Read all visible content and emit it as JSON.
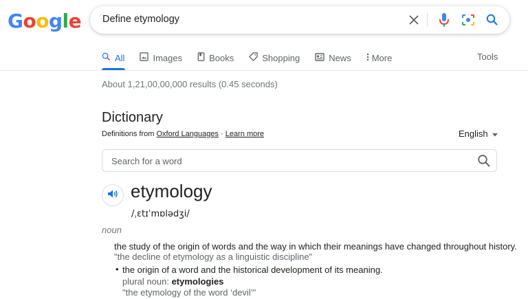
{
  "logo": {
    "letters": [
      "G",
      "o",
      "o",
      "g",
      "l",
      "e"
    ],
    "colors": [
      "#4285f4",
      "#ea4335",
      "#fbbc05",
      "#4285f4",
      "#34a853",
      "#ea4335"
    ]
  },
  "search": {
    "query": "Define etymology"
  },
  "icons": {
    "clear": "close-icon",
    "voice": "mic-icon",
    "lens": "camera-icon",
    "search": "search-icon"
  },
  "tabs": [
    {
      "label": "All",
      "icon": "search-icon",
      "active": true
    },
    {
      "label": "Images",
      "icon": "image-icon"
    },
    {
      "label": "Books",
      "icon": "book-icon"
    },
    {
      "label": "Shopping",
      "icon": "tag-icon"
    },
    {
      "label": "News",
      "icon": "news-icon"
    },
    {
      "label": "More",
      "icon": "more-vert-icon"
    }
  ],
  "tools_label": "Tools",
  "result_stats": "About 1,21,00,00,000 results (0.45 seconds)",
  "dictionary": {
    "title": "Dictionary",
    "source_prefix": "Definitions from ",
    "source_link": "Oxford Languages",
    "separator": " · ",
    "learn_more": "Learn more",
    "language": "English",
    "word_search_placeholder": "Search for a word",
    "headword": "etymology",
    "phonetic": "/ˌɛtɪˈmɒlədʒi/",
    "part_of_speech": "noun",
    "definitions": [
      {
        "text": "the study of the origin of words and the way in which their meanings have changed throughout history.",
        "example": "\"the decline of etymology as a linguistic discipline\""
      },
      {
        "text": "the origin of a word and the historical development of its meaning.",
        "plural_label": "plural noun: ",
        "plural_value": "etymologies",
        "example": "\"the etymology of the word ‘devil’\""
      }
    ]
  },
  "colors": {
    "accent": "#1a73e8",
    "text": "#202124",
    "muted": "#70757a"
  }
}
